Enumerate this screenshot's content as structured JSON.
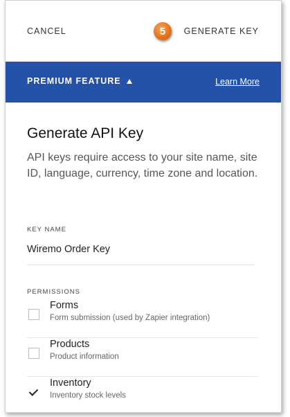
{
  "header": {
    "cancel_label": "CANCEL",
    "step_number": "5",
    "generate_label": "GENERATE KEY"
  },
  "banner": {
    "title": "PREMIUM FEATURE",
    "learn_more": "Learn More",
    "color": "#2352a8"
  },
  "main": {
    "heading": "Generate API Key",
    "description": "API keys require access to your site name, site ID, language, currency, time zone and location.",
    "key_name_label": "KEY NAME",
    "key_name_value": "Wiremo Order Key",
    "permissions_label": "PERMISSIONS",
    "permissions": [
      {
        "title": "Forms",
        "subtitle": "Form submission (used by Zapier integration)",
        "checked": false
      },
      {
        "title": "Products",
        "subtitle": "Product information",
        "checked": false
      },
      {
        "title": "Inventory",
        "subtitle": "Inventory stock levels",
        "checked": true
      }
    ]
  },
  "colors": {
    "badge": "#e8731c"
  }
}
